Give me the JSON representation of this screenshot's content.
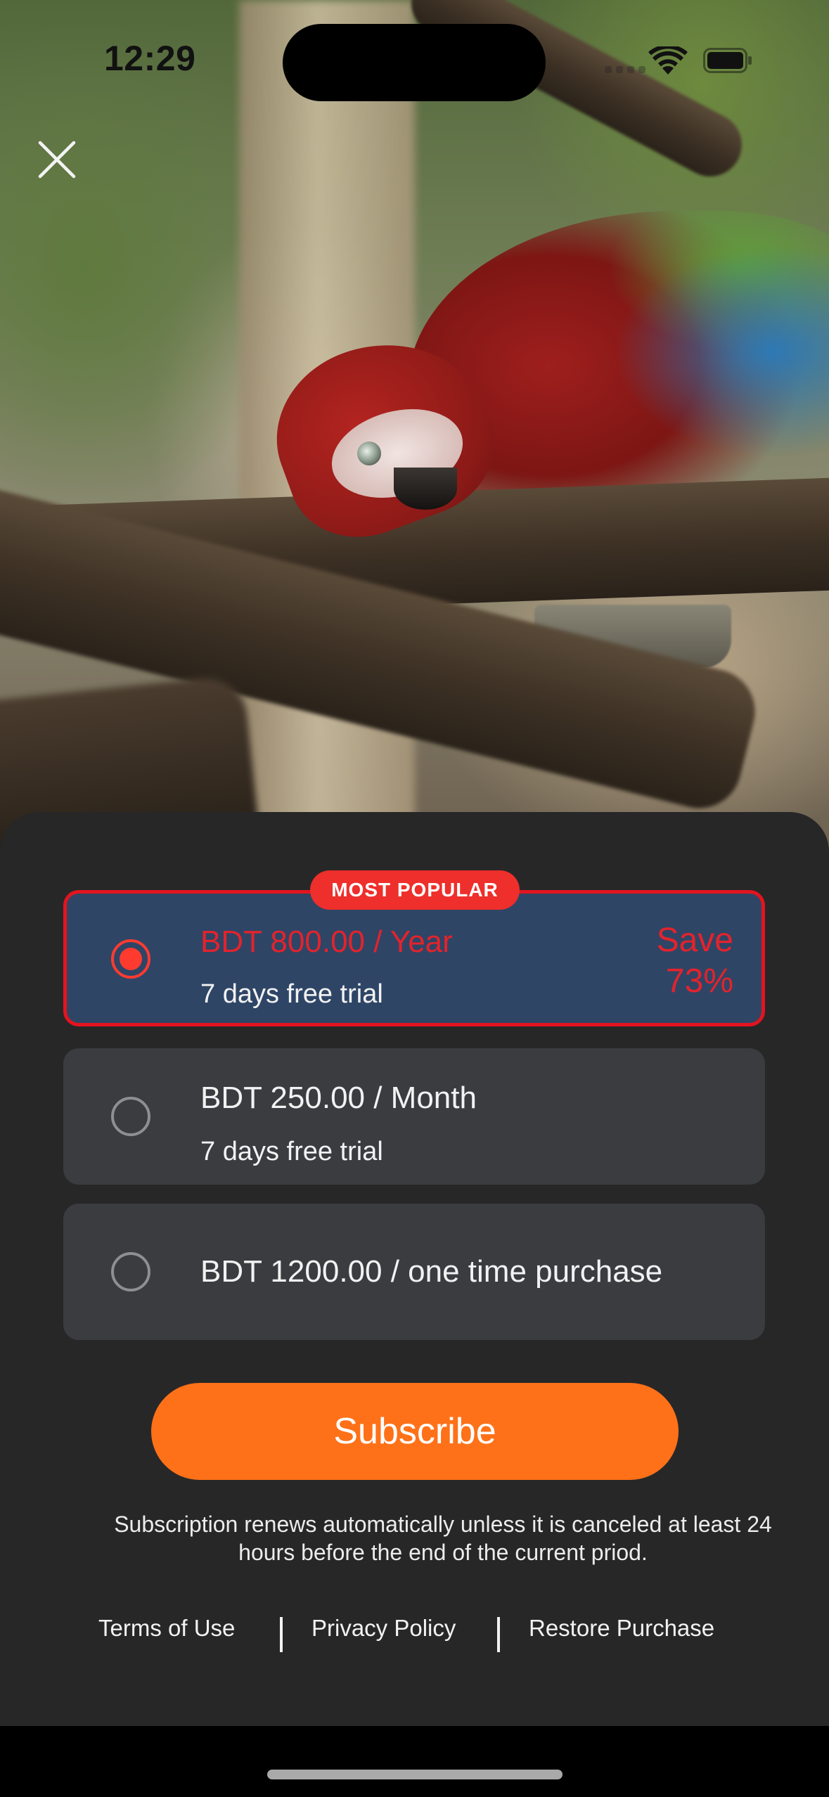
{
  "status_bar": {
    "time": "12:29"
  },
  "close": {
    "icon": "close-icon"
  },
  "plans": [
    {
      "title": "BDT 800.00 / Year",
      "subtitle": "7 days free trial",
      "badge": "MOST POPULAR",
      "save_line1": "Save",
      "save_line2": "73%",
      "selected": true
    },
    {
      "title": "BDT 250.00 / Month",
      "subtitle": "7 days free trial",
      "selected": false
    },
    {
      "title": "BDT 1200.00 / one time purchase",
      "selected": false
    }
  ],
  "subscribe_label": "Subscribe",
  "disclaimer": "Subscription renews automatically unless it is canceled at least 24 hours before the end of the current priod.",
  "footer": {
    "terms": "Terms of Use",
    "privacy": "Privacy Policy",
    "restore": "Restore Purchase"
  },
  "colors": {
    "accent_orange": "#FE7118",
    "selected_red": "#E3141F",
    "badge_red": "#EE2F2B",
    "selected_card": "#2E4566",
    "card": "#3A3C40",
    "sheet": "#272728"
  }
}
